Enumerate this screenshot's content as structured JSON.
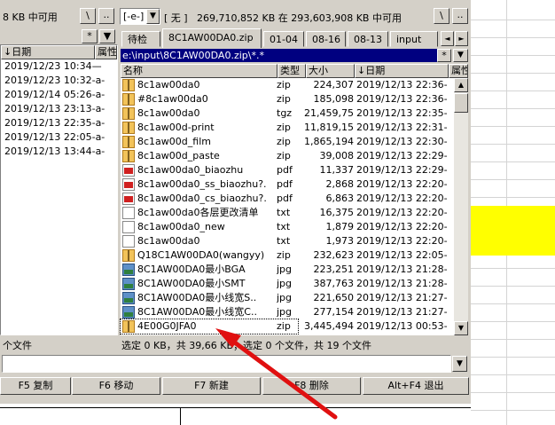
{
  "left_panel": {
    "drive_free_text": "8 KB 中可用",
    "root_button": "\\",
    "up_button": "..",
    "star_button": "*",
    "col_date": "↓日期",
    "col_attr": "属性",
    "dates": [
      "2019/12/23 10:34—",
      "2019/12/23 10:32-a-",
      "2019/12/14 05:26-a-",
      "2019/12/13 23:13-a-",
      "2019/12/13 22:35-a-",
      "2019/12/13 22:05-a-",
      "2019/12/13 13:44-a-"
    ],
    "status": "个文件"
  },
  "right_panel": {
    "drive": "[-e-]",
    "volume_label": "[ 无 ]",
    "free_space": "269,710,852 KB 在 293,603,908 KB 中可用",
    "root_button": "\\",
    "up_button": "..",
    "star_button": "*",
    "tabs": [
      "待检",
      "8C1AW00DA0.zip",
      "01-04",
      "08-16",
      "08-13",
      "input"
    ],
    "active_tab": "8C1AW00DA0.zip",
    "tab_prev": "◄",
    "tab_next": "►",
    "path": "e:\\input\\8C1AW00DA0.zip\\*.*",
    "columns": {
      "name": "名称",
      "type": "类型",
      "size": "大小",
      "date": "↓日期",
      "attr": "属性"
    },
    "files": [
      {
        "icon": "zip-icon",
        "name": "8c1aw00da0",
        "type": "zip",
        "size": "224,307",
        "date": "2019/12/13 22:36-"
      },
      {
        "icon": "zip-icon",
        "name": "#8c1aw00da0",
        "type": "zip",
        "size": "185,098",
        "date": "2019/12/13 22:36-"
      },
      {
        "icon": "zip-icon",
        "name": "8c1aw00da0",
        "type": "tgz",
        "size": "21,459,758",
        "date": "2019/12/13 22:35-"
      },
      {
        "icon": "zip-icon",
        "name": "8c1aw00d-print",
        "type": "zip",
        "size": "11,819,156",
        "date": "2019/12/13 22:31-"
      },
      {
        "icon": "zip-icon",
        "name": "8c1aw00d_film",
        "type": "zip",
        "size": "1,865,194",
        "date": "2019/12/13 22:30-"
      },
      {
        "icon": "zip-icon",
        "name": "8c1aw00d_paste",
        "type": "zip",
        "size": "39,008",
        "date": "2019/12/13 22:29-"
      },
      {
        "icon": "pdf-icon",
        "name": "8c1aw00da0_biaozhu",
        "type": "pdf",
        "size": "11,337",
        "date": "2019/12/13 22:29-"
      },
      {
        "icon": "pdf-icon",
        "name": "8c1aw00da0_ss_biaozhu?.",
        "type": "pdf",
        "size": "2,868",
        "date": "2019/12/13 22:20-"
      },
      {
        "icon": "pdf-icon",
        "name": "8c1aw00da0_cs_biaozhu?.",
        "type": "pdf",
        "size": "6,863",
        "date": "2019/12/13 22:20-"
      },
      {
        "icon": "txt-icon",
        "name": "8c1aw00da0各层更改清单",
        "type": "txt",
        "size": "16,375",
        "date": "2019/12/13 22:20-"
      },
      {
        "icon": "txt-icon",
        "name": "8c1aw00da0_new",
        "type": "txt",
        "size": "1,879",
        "date": "2019/12/13 22:20-"
      },
      {
        "icon": "txt-icon",
        "name": "8c1aw00da0",
        "type": "txt",
        "size": "1,973",
        "date": "2019/12/13 22:20-"
      },
      {
        "icon": "zip-icon",
        "name": "Q18C1AW00DA0(wangyy)",
        "type": "zip",
        "size": "232,623",
        "date": "2019/12/13 22:05-"
      },
      {
        "icon": "jpg-icon",
        "name": "8C1AW00DA0最小BGA",
        "type": "jpg",
        "size": "223,251",
        "date": "2019/12/13 21:28-"
      },
      {
        "icon": "jpg-icon",
        "name": "8C1AW00DA0最小SMT",
        "type": "jpg",
        "size": "387,763",
        "date": "2019/12/13 21:28-"
      },
      {
        "icon": "jpg-icon",
        "name": "8C1AW00DA0最小线宽S..",
        "type": "jpg",
        "size": "221,650",
        "date": "2019/12/13 21:27-"
      },
      {
        "icon": "jpg-icon",
        "name": "8C1AW00DA0最小线宽C..",
        "type": "jpg",
        "size": "277,154",
        "date": "2019/12/13 21:27-"
      },
      {
        "icon": "zip-icon",
        "name": "4E00G0JFA0",
        "type": "zip",
        "size": "3,445,494",
        "date": "2019/12/13 00:53-"
      }
    ],
    "status": "选定 0 KB，共 39,66   KB；选定 0 个文件，共 19 个文件"
  },
  "command_line": "",
  "function_keys": [
    "F5 复制",
    "F6 移动",
    "F7 新建",
    "F8 删除",
    "Alt+F4 退出"
  ],
  "colors": {
    "selection": "#000080",
    "sheet_highlight": "#ffff00",
    "arrow": "#e01010"
  }
}
